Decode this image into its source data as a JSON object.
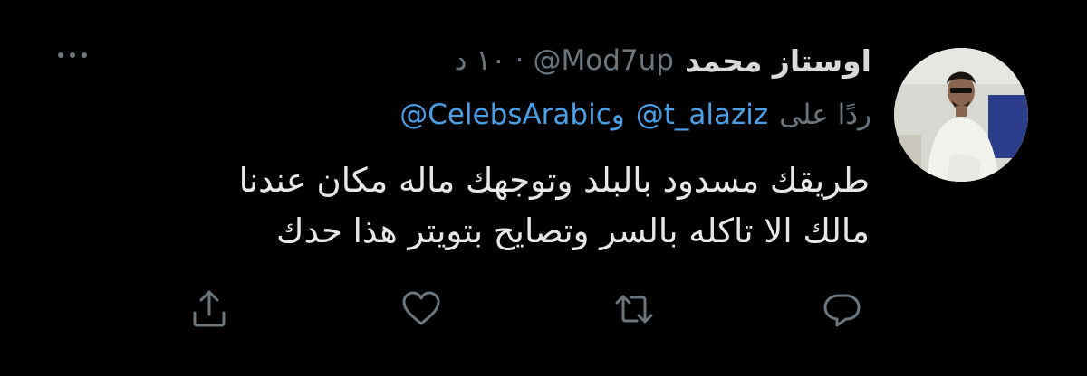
{
  "tweet": {
    "author": {
      "display_name": "اوستاز محمد",
      "handle": "@Mod7up",
      "separator": "·",
      "time": "١٠ د"
    },
    "reply": {
      "prefix": "ردًا على",
      "mention_1": "@t_alaziz",
      "conjunction": "و",
      "mention_2": "@CelebsArabic"
    },
    "body_lines": [
      "طريقك مسدود بالبلد وتوجهك ماله مكان عندنا",
      "مالك الا تاكله بالسر وتصايح بتويتر هذا حدك"
    ]
  },
  "actions": [
    "comment-icon",
    "retweet-icon",
    "like-icon",
    "share-icon"
  ],
  "colors": {
    "background": "#000000",
    "name": "#d9d9d9",
    "secondary": "#6e767d",
    "link": "#4a9fe5",
    "text": "#e8e8e8"
  }
}
